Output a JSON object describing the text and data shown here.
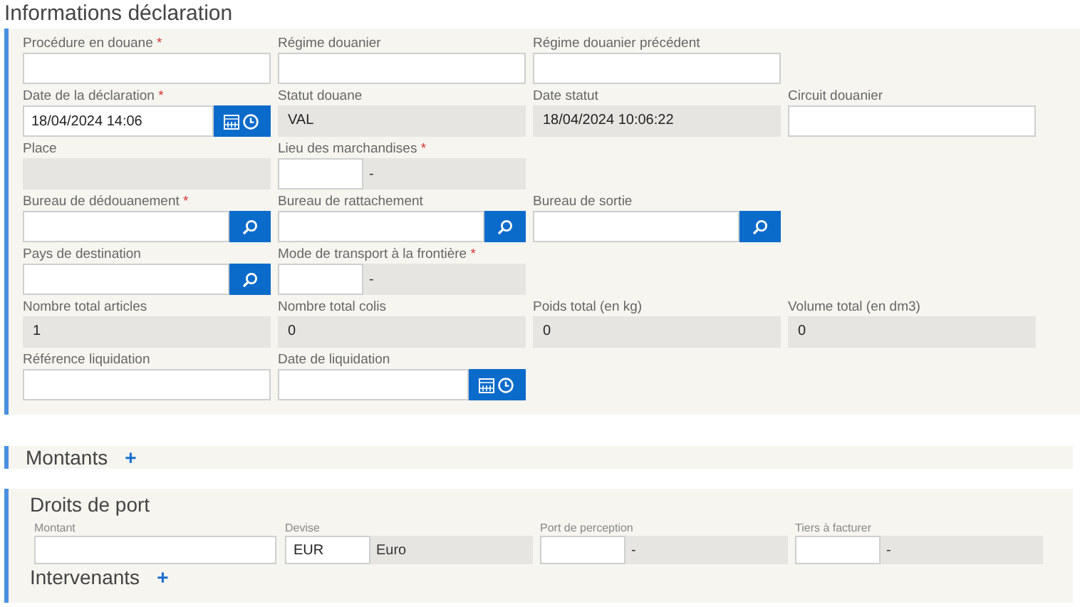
{
  "declaration": {
    "title": "Informations déclaration",
    "rows": [
      [
        {
          "label": "Procédure en douane",
          "required_mark": "*",
          "kind": "text"
        },
        {
          "label": "Régime douanier",
          "kind": "text"
        },
        {
          "label": "Régime douanier précédent",
          "kind": "text"
        }
      ],
      [
        {
          "label": "Date de la déclaration",
          "required_mark": "*",
          "kind": "date",
          "value": "18/04/2024 14:06"
        },
        {
          "label": "Statut douane",
          "kind": "readonly",
          "value": "VAL"
        },
        {
          "label": "Date statut",
          "kind": "readonly",
          "value": "18/04/2024 10:06:22"
        },
        {
          "label": "Circuit douanier",
          "kind": "text"
        }
      ],
      [
        {
          "label": "Place",
          "kind": "readonly"
        },
        {
          "label": "Lieu des marchandises",
          "required_mark": "*",
          "kind": "code",
          "description": "-"
        }
      ],
      [
        {
          "label": "Bureau de dédouanement",
          "required_mark": "*",
          "kind": "lookup"
        },
        {
          "label": "Bureau de rattachement",
          "kind": "lookup"
        },
        {
          "label": "Bureau de sortie",
          "kind": "lookup"
        }
      ],
      [
        {
          "label": "Pays de destination",
          "kind": "lookup"
        },
        {
          "label": "Mode de transport à la frontière",
          "required_mark": "*",
          "kind": "code",
          "description": "-"
        }
      ],
      [
        {
          "label": "Nombre total articles",
          "kind": "readonly",
          "value": "1"
        },
        {
          "label": "Nombre total colis",
          "kind": "readonly",
          "value": "0"
        },
        {
          "label": "Poids total (en kg)",
          "kind": "readonly",
          "value": "0"
        },
        {
          "label": "Volume total (en dm3)",
          "kind": "readonly",
          "value": "0"
        }
      ],
      [
        {
          "label": "Référence liquidation",
          "kind": "text"
        },
        {
          "label": "Date de liquidation",
          "kind": "date"
        }
      ]
    ]
  },
  "amounts": {
    "title": "Montants",
    "expand_symbol": "+"
  },
  "port_dues": {
    "title": "Droits de port",
    "fields": [
      {
        "label": "Montant",
        "kind": "text"
      },
      {
        "label": "Devise",
        "kind": "code",
        "value": "EUR",
        "description": "Euro"
      },
      {
        "label": "Port de perception",
        "kind": "code",
        "description": "-"
      },
      {
        "label": "Tiers à facturer",
        "kind": "code",
        "description": "-"
      }
    ]
  },
  "parties": {
    "title": "Intervenants",
    "expand_symbol": "+"
  }
}
